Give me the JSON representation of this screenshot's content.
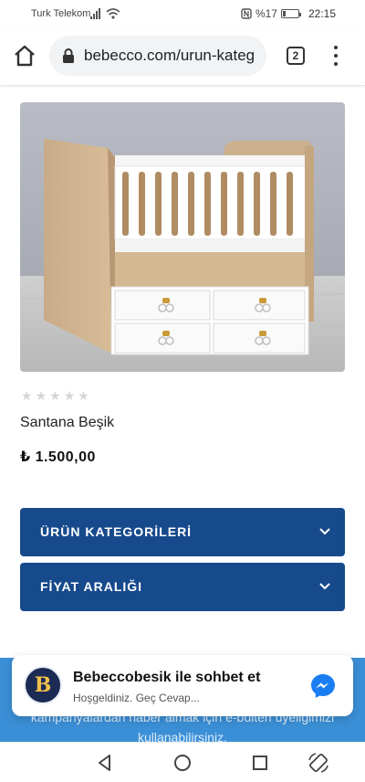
{
  "status_bar": {
    "carrier": "Turk Telekom",
    "battery_text": "%17",
    "battery_level": 0.17,
    "time": "22:15"
  },
  "browser": {
    "url": "bebecco.com/urun-kateg",
    "tab_count": "2"
  },
  "product": {
    "rating_stars": 5,
    "rating_value": 0,
    "title": "Santana Beşik",
    "price": "₺ 1.500,00"
  },
  "filters": [
    {
      "label": "ÜRÜN KATEGORİLERİ"
    },
    {
      "label": "FİYAT ARALIĞI"
    }
  ],
  "promo": {
    "text": "kampanyalardan haber almak için e-bülten üyeliğimizi kullanabilirsiniz."
  },
  "chat": {
    "title": "Bebeccobesik ile sohbet et",
    "subtitle": "Hoşgeldiniz. Geç Cevap...",
    "avatar_letter": "B"
  },
  "colors": {
    "accordion_bg": "#174a8c",
    "promo_bg": "#3b8fd6",
    "messenger_blue": "#1a7ef2"
  },
  "icons": {
    "home": "home-icon",
    "lock": "lock-icon",
    "menu": "more-vert-icon",
    "chevron": "chevron-down-icon",
    "messenger": "messenger-icon",
    "back": "nav-back-icon",
    "home_nav": "nav-home-icon",
    "recents": "nav-recents-icon",
    "rotate": "rotate-icon"
  }
}
